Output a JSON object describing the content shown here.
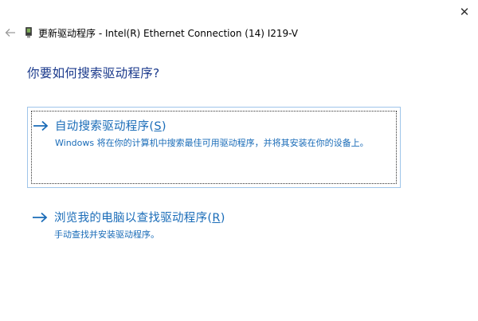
{
  "window": {
    "close_glyph": "✕",
    "title": "更新驱动程序 - Intel(R) Ethernet Connection (14) I219-V"
  },
  "heading": "你要如何搜索驱动程序?",
  "options": [
    {
      "title_main": "自动搜索驱动程序(",
      "title_key": "S",
      "title_end": ")",
      "description": "Windows 将在你的计算机中搜索最佳可用驱动程序，并将其安装在你的设备上。"
    },
    {
      "title_main": "浏览我的电脑以查找驱动程序(",
      "title_key": "R",
      "title_end": ")",
      "description": "手动查找并安装驱动程序。"
    }
  ],
  "icons": {
    "back": "back-arrow-icon",
    "device": "device-icon",
    "option_arrow": "right-arrow-icon"
  },
  "colors": {
    "heading": "#1b3a8c",
    "link": "#1a6cb8",
    "box_border": "#9fc5ea"
  }
}
